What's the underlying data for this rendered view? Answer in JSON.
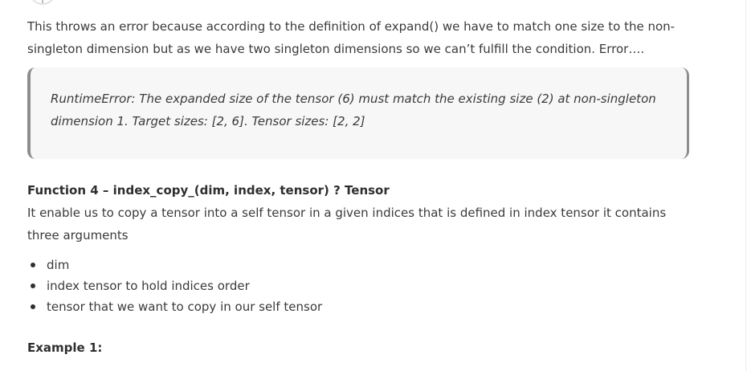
{
  "intro_paragraph": {
    "line1": "This throws an error because according to the definition of expand() we have to match one size to the non-",
    "line2": "singleton dimension but as we have two singleton dimensions so we can’t fulfill the condition. Error…."
  },
  "error_quote": {
    "line1": "RuntimeError: The expanded size of the tensor (6) must match the existing size (2) at non-singleton",
    "line2": "dimension 1. Target sizes: [2, 6]. Tensor sizes: [2,  2]"
  },
  "function_heading": "Function 4 – index_copy_(dim, index, tensor) ? Tensor",
  "function_description": {
    "line1": "It enable us to copy a tensor into a self tensor in a given indices that is defined in index tensor it contains",
    "line2": "three arguments"
  },
  "arguments": [
    "dim",
    "index tensor to hold indices order",
    "tensor that we want to copy in our self tensor"
  ],
  "example_heading": "Example 1:"
}
